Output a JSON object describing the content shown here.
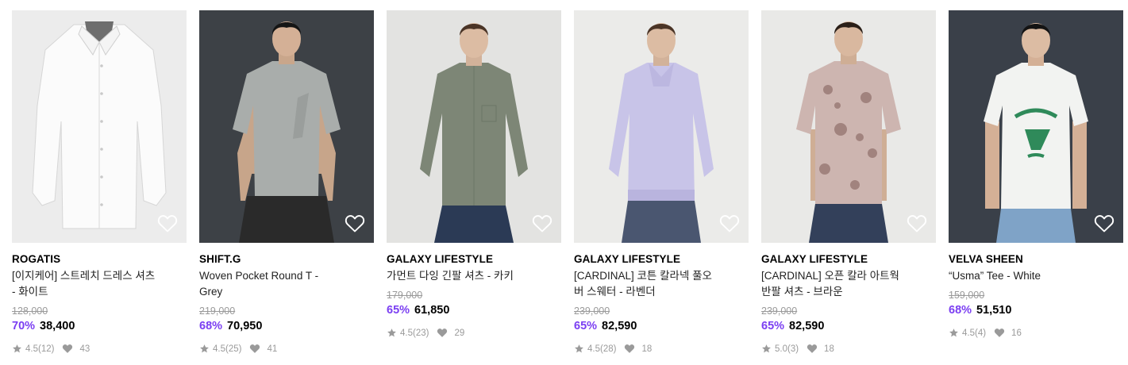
{
  "colors": {
    "discount": "#7b3ff2",
    "muted": "#9a9a9a",
    "icon": "#ffffff"
  },
  "products": [
    {
      "brand": "ROGATIS",
      "name_lines": [
        "[이지케어] 스트레치 드레스 셔츠",
        "- 화이트"
      ],
      "original_price": "128,000",
      "discount": "70%",
      "price": "38,400",
      "rating": "4.5(12)",
      "likes": "43",
      "image": "white-dress-shirt"
    },
    {
      "brand": "SHIFT.G",
      "name_lines": [
        "Woven Pocket Round T -",
        "Grey"
      ],
      "original_price": "219,000",
      "discount": "68%",
      "price": "70,950",
      "rating": "4.5(25)",
      "likes": "41",
      "image": "model-grey-tee"
    },
    {
      "brand": "GALAXY LIFESTYLE",
      "name_lines": [
        "가먼트 다잉 긴팔 셔츠 - 카키"
      ],
      "original_price": "179,000",
      "discount": "65%",
      "price": "61,850",
      "rating": "4.5(23)",
      "likes": "29",
      "image": "model-khaki-shirt"
    },
    {
      "brand": "GALAXY LIFESTYLE",
      "name_lines": [
        "[CARDINAL] 코튼 칼라넥 풀오",
        "버 스웨터 - 라벤더"
      ],
      "original_price": "239,000",
      "discount": "65%",
      "price": "82,590",
      "rating": "4.5(28)",
      "likes": "18",
      "image": "model-lavender-sweater"
    },
    {
      "brand": "GALAXY LIFESTYLE",
      "name_lines": [
        "[CARDINAL] 오픈 칼라 아트웍",
        "반팔 셔츠 - 브라운"
      ],
      "original_price": "239,000",
      "discount": "65%",
      "price": "82,590",
      "rating": "5.0(3)",
      "likes": "18",
      "image": "model-floral-shirt"
    },
    {
      "brand": "VELVA SHEEN",
      "name_lines": [
        "“Usma” Tee - White"
      ],
      "original_price": "159,000",
      "discount": "68%",
      "price": "51,510",
      "rating": "4.5(4)",
      "likes": "16",
      "image": "model-usma-tee"
    }
  ]
}
